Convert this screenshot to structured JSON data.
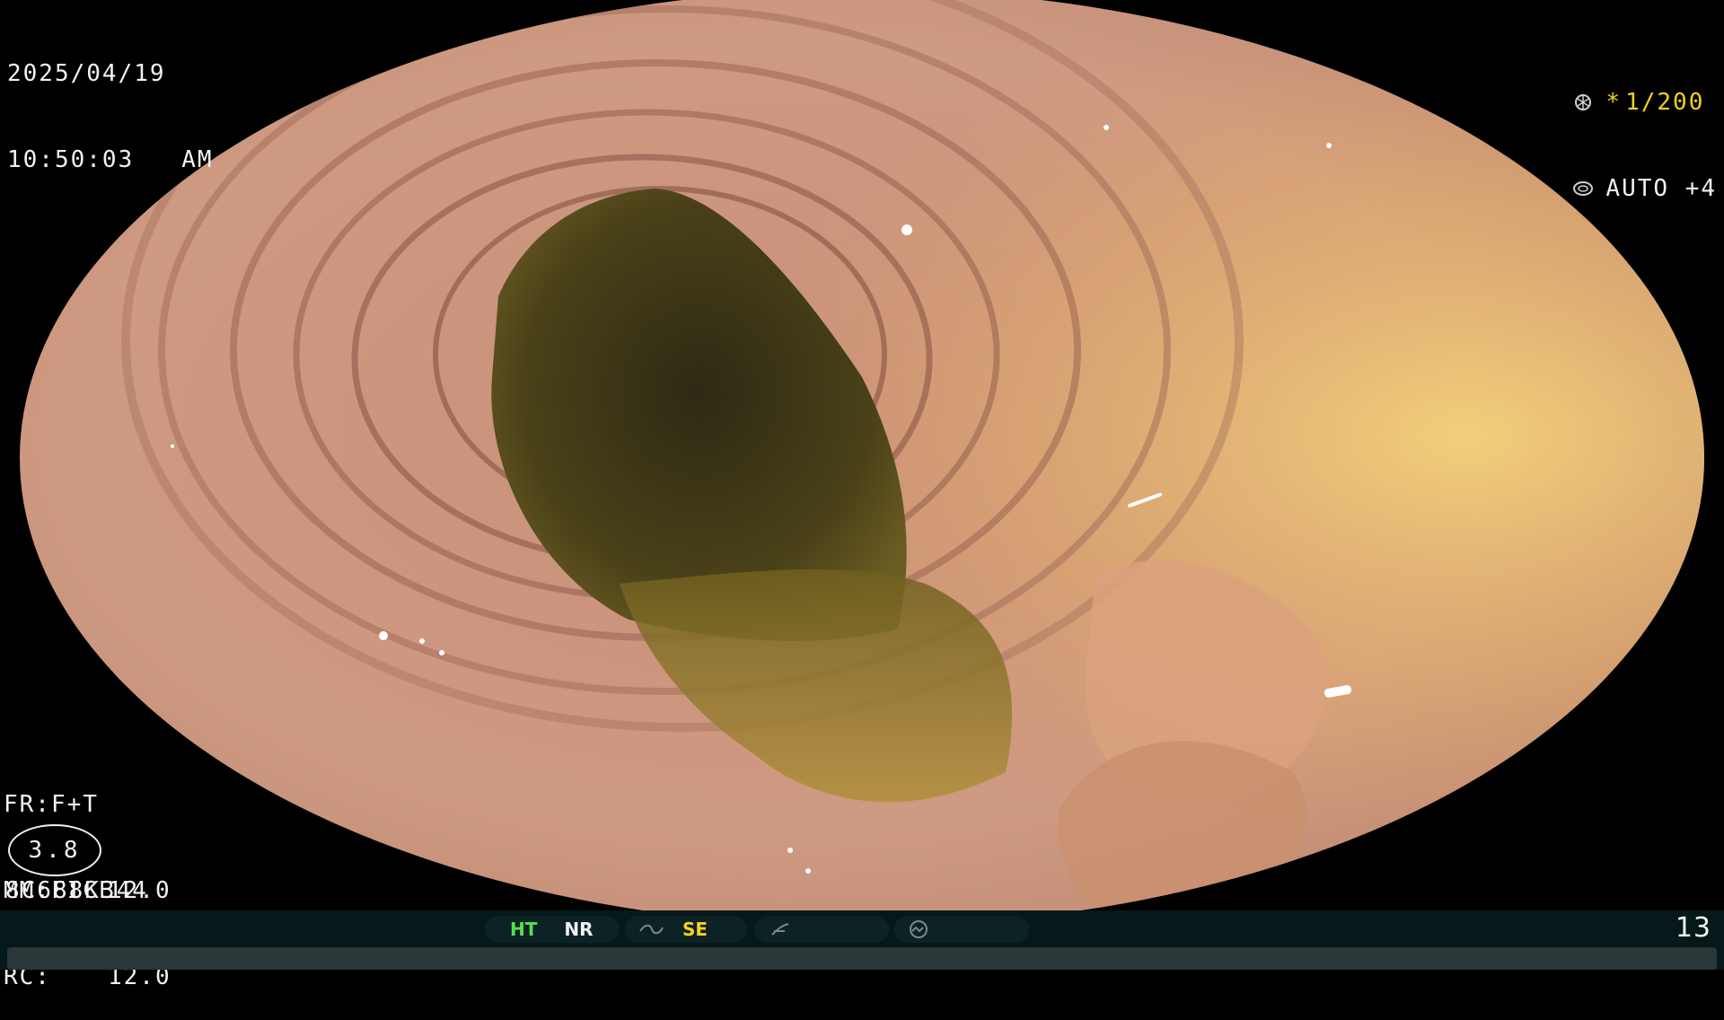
{
  "overlay": {
    "date": "2025/04/19",
    "time": "10:50:03",
    "meridiem": "AM",
    "exposure_star": "*",
    "shutter": "1/200",
    "auto_mode": "AUTO +4",
    "fr_setting": "FR:F+T",
    "mm_setting": "MM:FICE",
    "rc_setting": "RC:",
    "iris_value": "3.8",
    "gain_1": "12.0",
    "gain_2": "12.0",
    "serial": "8C688K344",
    "frame_number": "13"
  },
  "toolbar": {
    "ht_label": "HT",
    "nr_label": "NR",
    "se_label": "SE"
  },
  "colors": {
    "ht": "#59e04d",
    "se": "#f3d21a",
    "bar": "#05191a"
  },
  "icons": [
    "aperture-icon",
    "gear-ring-icon",
    "tilde-icon",
    "slash-icon",
    "scope-icon"
  ]
}
